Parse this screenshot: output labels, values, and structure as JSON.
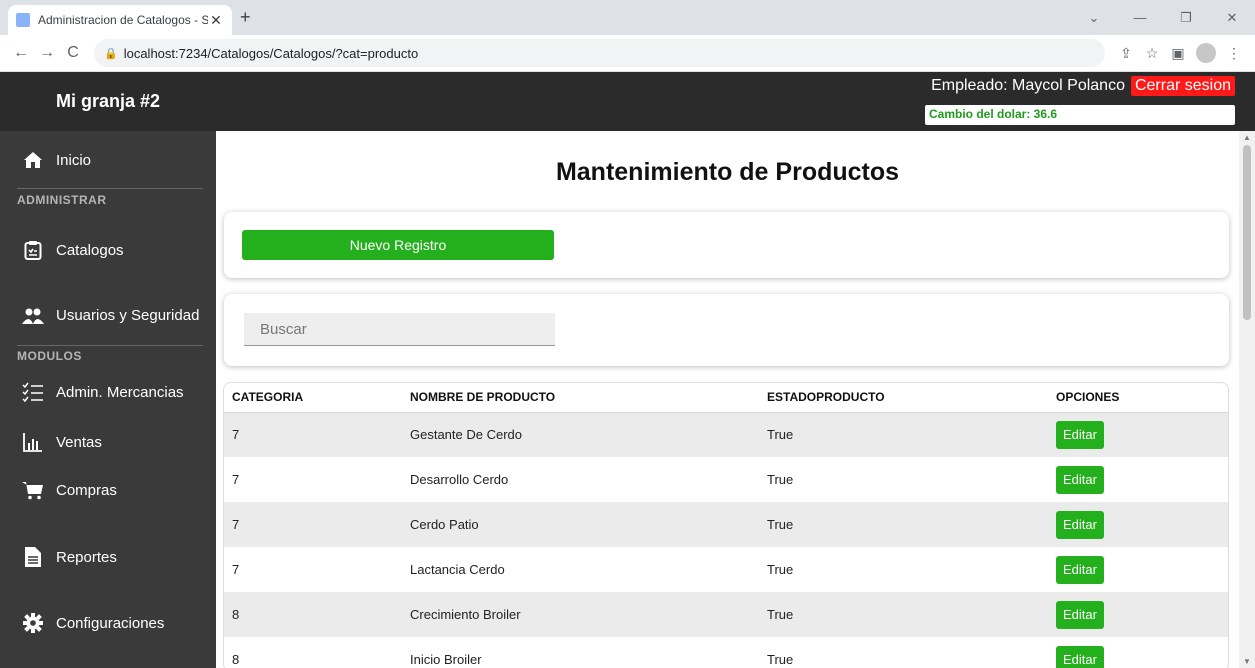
{
  "browser": {
    "tab_title": "Administracion de Catalogos - S",
    "url": "localhost:7234/Catalogos/Catalogos/?cat=producto"
  },
  "app": {
    "brand": "Mi granja #2",
    "employee_label": "Empleado: Maycol Polanco",
    "logout_label": "Cerrar sesion",
    "dollar_rate": "Cambio del dolar: 36.6"
  },
  "sidebar": {
    "section_admin": "ADMINISTRAR",
    "section_modules": "MODULOS",
    "items": [
      {
        "label": "Inicio",
        "icon": "home-icon"
      },
      {
        "label": "Catalogos",
        "icon": "clipboard-icon"
      },
      {
        "label": "Usuarios y Seguridad",
        "icon": "users-icon"
      },
      {
        "label": "Admin. Mercancias",
        "icon": "checklist-icon"
      },
      {
        "label": "Ventas",
        "icon": "bar-chart-icon"
      },
      {
        "label": "Compras",
        "icon": "cart-icon"
      },
      {
        "label": "Reportes",
        "icon": "file-icon"
      },
      {
        "label": "Configuraciones",
        "icon": "gear-icon"
      }
    ]
  },
  "main": {
    "title": "Mantenimiento de Productos",
    "new_button": "Nuevo Registro",
    "search_placeholder": "Buscar"
  },
  "table": {
    "headers": [
      "CATEGORIA",
      "NOMBRE DE PRODUCTO",
      "ESTADOPRODUCTO",
      "OPCIONES"
    ],
    "edit_label": "Editar",
    "rows": [
      {
        "categoria": "7",
        "nombre": "Gestante De Cerdo",
        "estado": "True"
      },
      {
        "categoria": "7",
        "nombre": "Desarrollo Cerdo",
        "estado": "True"
      },
      {
        "categoria": "7",
        "nombre": "Cerdo Patio",
        "estado": "True"
      },
      {
        "categoria": "7",
        "nombre": "Lactancia Cerdo",
        "estado": "True"
      },
      {
        "categoria": "8",
        "nombre": "Crecimiento Broiler",
        "estado": "True"
      },
      {
        "categoria": "8",
        "nombre": "Inicio Broiler",
        "estado": "True"
      }
    ]
  },
  "colors": {
    "accent_green": "#24b01c",
    "logout_red": "#ff1a1a",
    "sidebar_bg": "#3a3a3a",
    "header_bg": "#2b2b2b"
  }
}
